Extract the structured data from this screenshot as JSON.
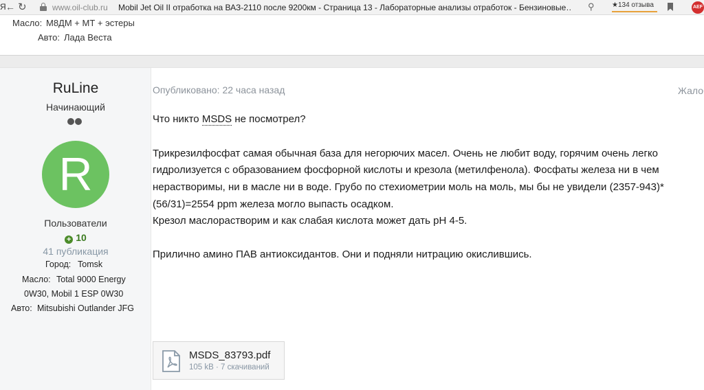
{
  "browser": {
    "ya": "Я",
    "domain": "www.oil-club.ru",
    "tab_title": "Mobil Jet Oil II отработка на ВАЗ-2110 после 9200км - Страница 13 - Лабораторные анализы отработок - Бензиновые…",
    "reviews": "★134 отзыва",
    "extension": "AEF"
  },
  "previous_post": {
    "oil_label": "Масло:",
    "oil_value": "М8ДМ + МТ + эстеры",
    "car_label": "Авто:",
    "car_value": "Лада Веста"
  },
  "author": {
    "name": "RuLine",
    "rank": "Начинающий",
    "avatar_letter": "R",
    "avatar_color": "#6cc261",
    "group": "Пользователи",
    "reputation": "10",
    "posts": "41 публикация",
    "city_label": "Город:",
    "city_value": "Tomsk",
    "oil_label": "Масло:",
    "oil_value_line1": "Total 9000 Energy",
    "oil_value_line2": "0W30, Mobil 1 ESP 0W30",
    "car_label": "Авто:",
    "car_value": "Mitsubishi Outlander JFG"
  },
  "post": {
    "date": "Опубликовано: 22 часа назад",
    "report": "Жалоба",
    "line1_prefix": "Что никто ",
    "line1_abbr": "MSDS",
    "line1_suffix": " не посмотрел?",
    "line2": "Трикрезилфосфат самая обычная база для негорючих масел. Очень не любит воду, горячим очень легко",
    "line3": "гидролизуется  с образованием фосфорной кислоты и крезола (метилфенола). Фосфаты железа ни в чем",
    "line4": "нерастворимы, ни в масле ни в воде. Грубо по стехиометрии моль на моль, мы бы не увидели (2357-943)*",
    "line5": "(56/31)=2554 ppm железа могло выпасть осадком.",
    "line6": "Крезол маслорастворим и как слабая кислота может дать pH 4-5.",
    "line7": "Прилично амино ПАВ антиоксидантов. Они и подняли нитрацию окислившись."
  },
  "attachment": {
    "filename": "MSDS_83793.pdf",
    "meta": "105 kB · 7 скачиваний"
  }
}
